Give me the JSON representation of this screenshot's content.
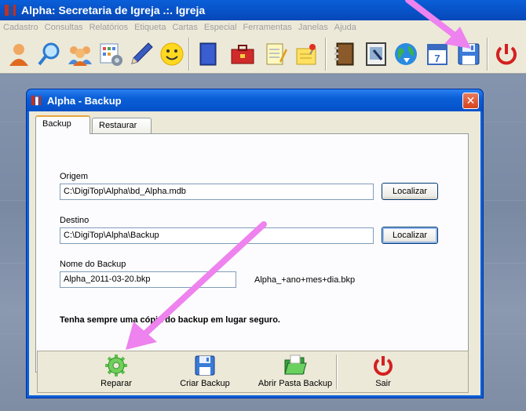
{
  "app": {
    "title": "Alpha: Secretaria de Igreja .:. Igreja"
  },
  "menu": {
    "items": [
      "Cadastro",
      "Consultas",
      "Relatórios",
      "Etiqueta",
      "Cartas",
      "Especial",
      "Ferramentas",
      "Janelas",
      "Ajuda"
    ]
  },
  "toolbar": {
    "buttons": [
      "person-icon",
      "magnifier-icon",
      "group-icon",
      "calendar-grid-icon",
      "pen-icon",
      "smiley-icon",
      "book-icon",
      "toolbox-icon",
      "notepad-icon",
      "note-pin-icon",
      "address-book-icon",
      "certificate-icon",
      "globe-icon",
      "calendar-icon",
      "save-disk-icon",
      "power-icon"
    ]
  },
  "dialog": {
    "title": "Alpha - Backup",
    "close": "✕",
    "tabs": [
      {
        "label": "Backup",
        "active": true
      },
      {
        "label": "Restaurar",
        "active": false
      }
    ],
    "origem": {
      "label": "Origem",
      "value": "C:\\DigiTop\\Alpha\\bd_Alpha.mdb",
      "button": "Localizar"
    },
    "destino": {
      "label": "Destino",
      "value": "C:\\DigiTop\\Alpha\\Backup",
      "button": "Localizar"
    },
    "nome": {
      "label": "Nome do Backup",
      "value": "Alpha_2011-03-20.bkp",
      "hint": "Alpha_+ano+mes+dia.bkp"
    },
    "warning": "Tenha sempre uma cópia do backup em lugar seguro.",
    "actions": [
      {
        "label": "Reparar",
        "icon": "gear-icon"
      },
      {
        "label": "Criar Backup",
        "icon": "save-disk-icon"
      },
      {
        "label": "Abrir Pasta Backup",
        "icon": "folder-open-icon"
      },
      {
        "label": "Sair",
        "icon": "power-icon"
      }
    ]
  },
  "colors": {
    "title_bar": "#0a5fd8",
    "dialog_bg": "#ece9d8",
    "arrow": "#ee82ee"
  }
}
